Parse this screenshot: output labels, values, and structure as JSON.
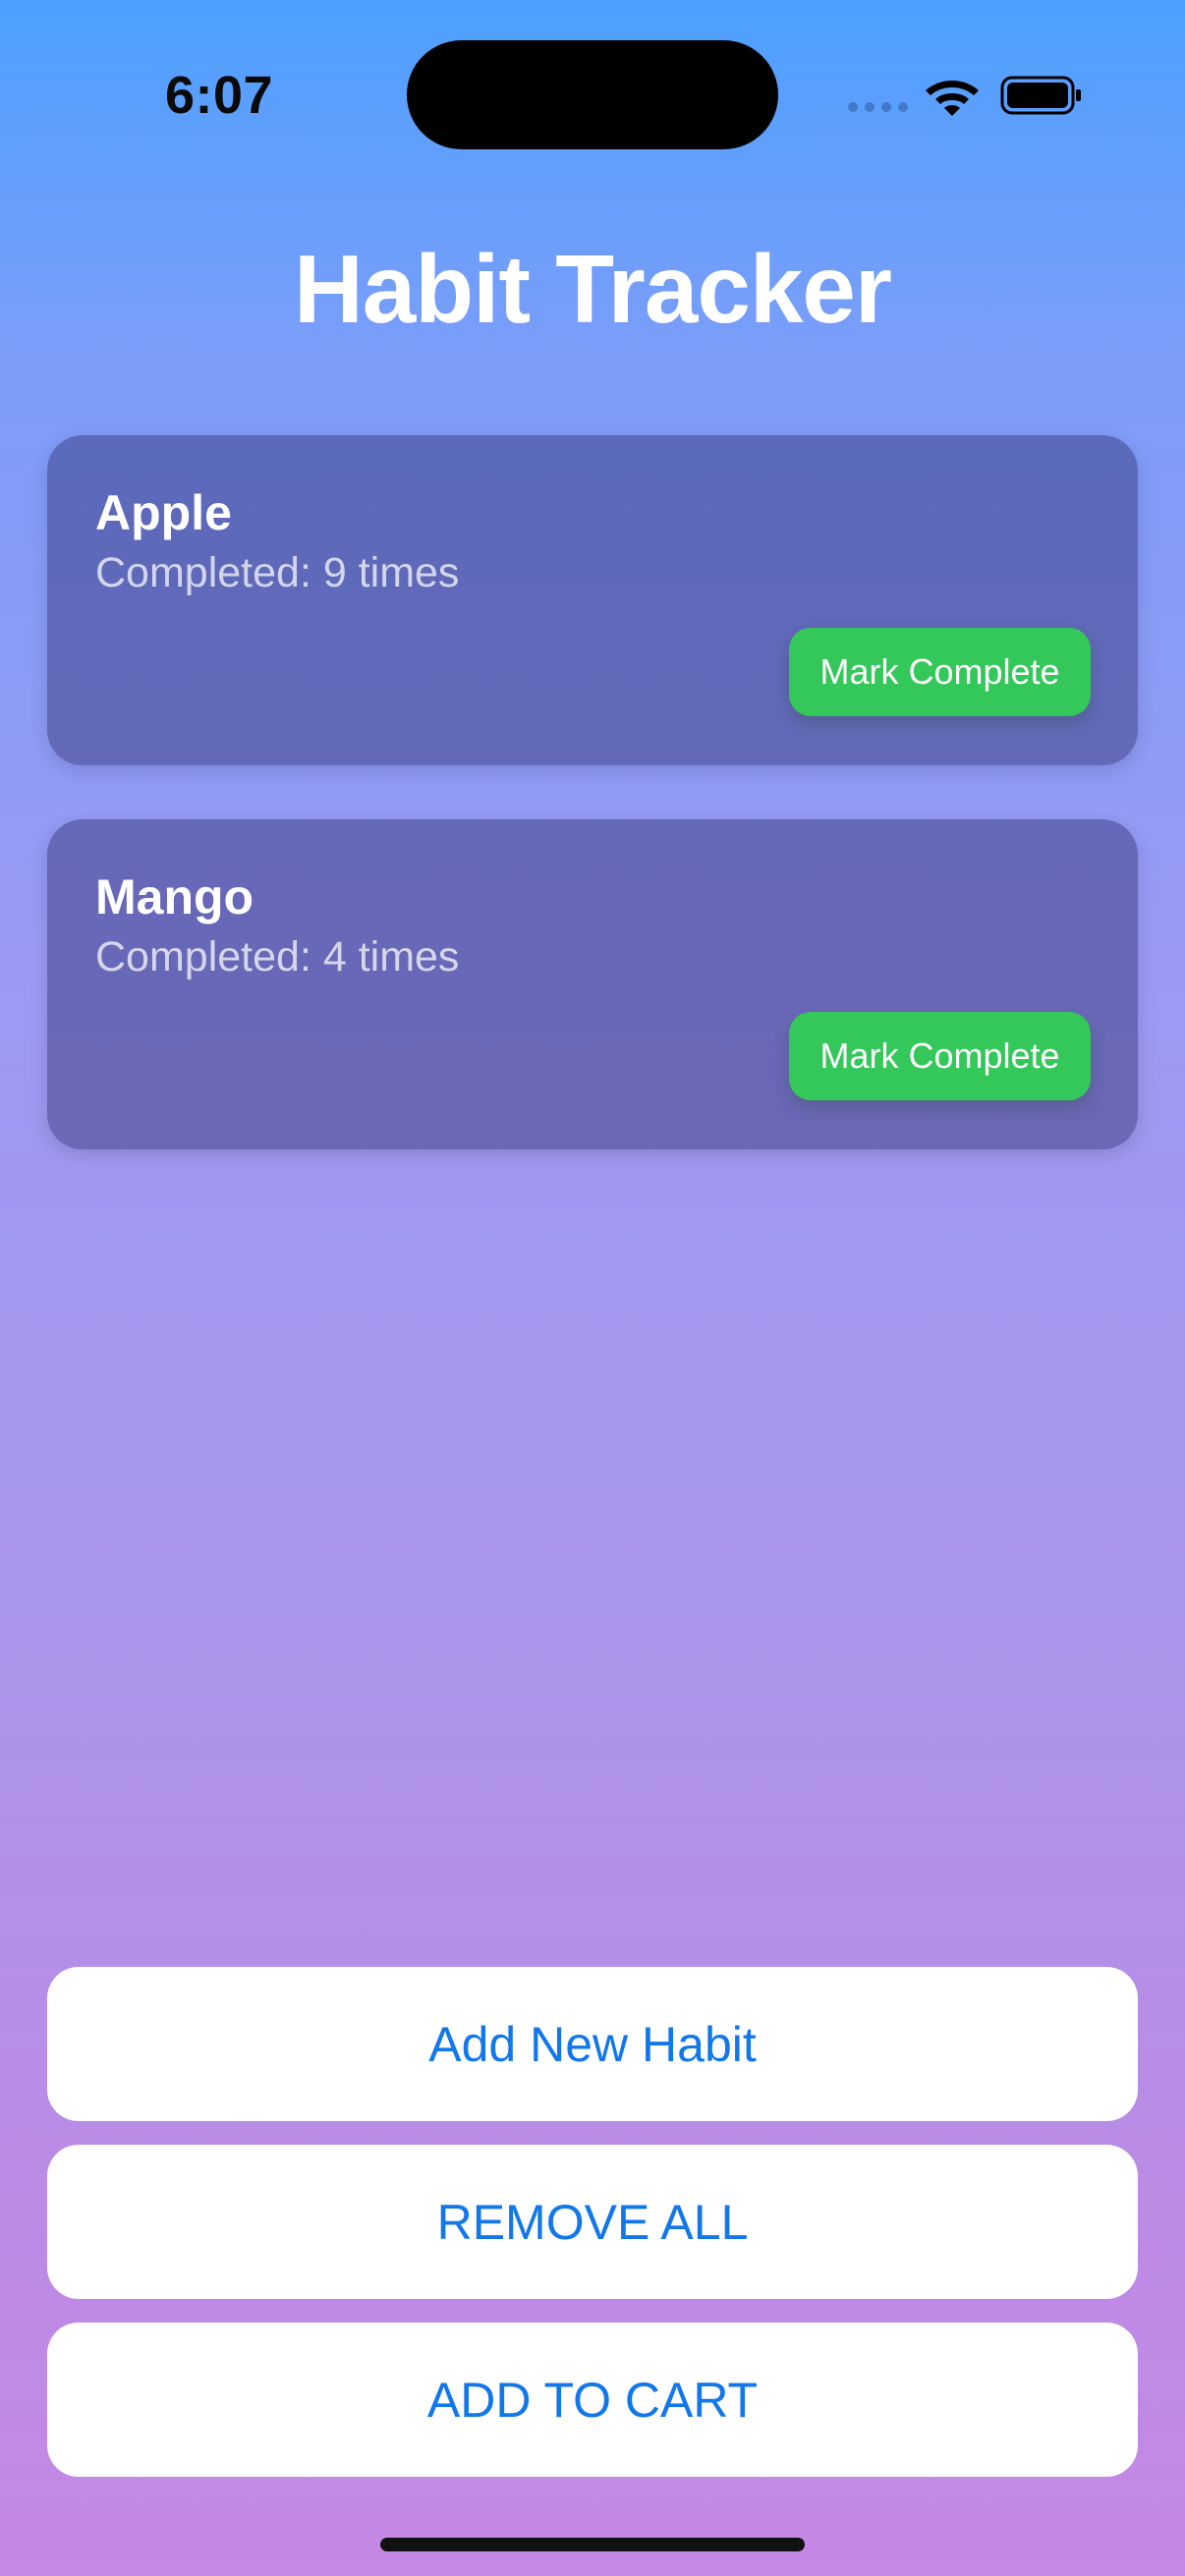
{
  "status_bar": {
    "time": "6:07",
    "icons": [
      "cellular-icon",
      "wifi-icon",
      "battery-icon"
    ]
  },
  "title": "Habit Tracker",
  "habits": [
    {
      "name": "Apple",
      "completed_text": "Completed: 9 times",
      "button_label": "Mark Complete"
    },
    {
      "name": "Mango",
      "completed_text": "Completed: 4 times",
      "button_label": "Mark Complete"
    }
  ],
  "actions": {
    "add_habit": "Add New Habit",
    "remove_all": "REMOVE ALL",
    "add_to_cart": "ADD TO CART"
  },
  "colors": {
    "accent_green": "#34c759",
    "button_text_blue": "#1277e8",
    "gradient_top": "#4da0ff",
    "gradient_bottom": "#c588e4"
  }
}
